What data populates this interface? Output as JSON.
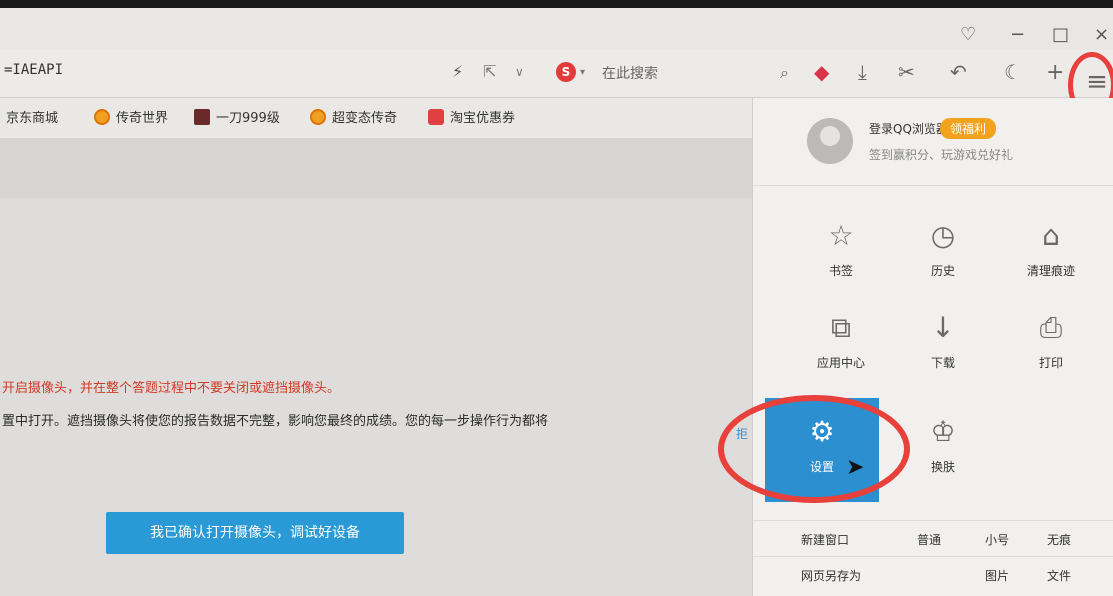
{
  "window": {
    "controls": {
      "skin": "♡",
      "minimize": "−",
      "restore": "□",
      "close": "×"
    }
  },
  "address_bar": {
    "url": "=IAEAPI",
    "icons": [
      "bolt-icon",
      "share-icon",
      "chevron-down-icon"
    ],
    "search_engine_icon": "S",
    "search_placeholder": "在此搜索"
  },
  "toolbar": {
    "icons": [
      "search-icon",
      "game-icon",
      "download-icon",
      "cut-icon",
      "undo-icon",
      "night-mode-icon",
      "add-icon"
    ],
    "menu_icon": "≡"
  },
  "bookmarks": [
    {
      "label": "京东商城",
      "icon": ""
    },
    {
      "label": "传奇世界",
      "icon": "orange"
    },
    {
      "label": "一刀999级",
      "icon": "pic"
    },
    {
      "label": "超变态传奇",
      "icon": "orange"
    },
    {
      "label": "淘宝优惠券",
      "icon": "red"
    }
  ],
  "page": {
    "warning": "开启摄像头，并在整个答题过程中不要关闭或遮挡摄像头。",
    "notice": "置中打开。遮挡摄像头将使您的报告数据不完整，影响您最终的成绩。您的每一步操作行为都将",
    "side_text": "拒",
    "confirm_button": "我已确认打开摄像头，调试好设备"
  },
  "menu_panel": {
    "login_text": "登录QQ浏览器",
    "benefit_badge": "领福利",
    "tagline": "签到赢积分、玩游戏兑好礼",
    "grid": [
      {
        "label": "书签",
        "icon": "☆"
      },
      {
        "label": "历史",
        "icon": "◷"
      },
      {
        "label": "清理痕迹",
        "icon": "⌂"
      },
      {
        "label": "应用中心",
        "icon": "⧉"
      },
      {
        "label": "下载",
        "icon": "↓"
      },
      {
        "label": "打印",
        "icon": "⎙"
      },
      {
        "label": "设置",
        "icon": "⚙"
      },
      {
        "label": "换肤",
        "icon": "♔"
      }
    ],
    "new_window": {
      "label": "新建窗口",
      "options": [
        "普通",
        "小号",
        "无痕"
      ]
    },
    "save_page": {
      "label": "网页另存为",
      "options": [
        "图片",
        "文件"
      ]
    }
  },
  "colors": {
    "accent": "#2b8fd0",
    "highlight_ring": "#e8403a",
    "warning_text": "#d23a2a"
  }
}
